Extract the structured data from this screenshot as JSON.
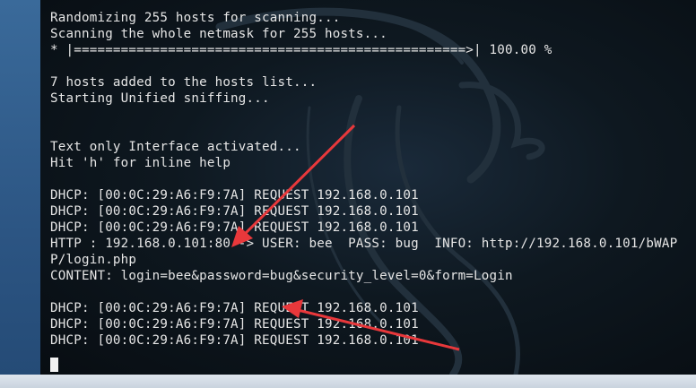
{
  "terminal": {
    "lines": [
      "",
      "Randomizing 255 hosts for scanning...",
      "Scanning the whole netmask for 255 hosts...",
      "* |==================================================>| 100.00 %",
      "",
      "7 hosts added to the hosts list...",
      "Starting Unified sniffing...",
      "",
      "",
      "Text only Interface activated...",
      "Hit 'h' for inline help",
      "",
      "DHCP: [00:0C:29:A6:F9:7A] REQUEST 192.168.0.101",
      "DHCP: [00:0C:29:A6:F9:7A] REQUEST 192.168.0.101",
      "DHCP: [00:0C:29:A6:F9:7A] REQUEST 192.168.0.101",
      "HTTP : 192.168.0.101:80 -> USER: bee  PASS: bug  INFO: http://192.168.0.101/bWAP",
      "P/login.php",
      "CONTENT: login=bee&password=bug&security_level=0&form=Login",
      "",
      "DHCP: [00:0C:29:A6:F9:7A] REQUEST 192.168.0.101",
      "DHCP: [00:0C:29:A6:F9:7A] REQUEST 192.168.0.101",
      "DHCP: [00:0C:29:A6:F9:7A] REQUEST 192.168.0.101"
    ]
  },
  "colors": {
    "terminal_text": "#e6e6e6",
    "annotation_arrow": "#e8383b",
    "cursor": "#f2f2f2"
  },
  "icons": {
    "background_logo": "kali-dragon-icon",
    "annotation": "red-arrow-icon"
  }
}
